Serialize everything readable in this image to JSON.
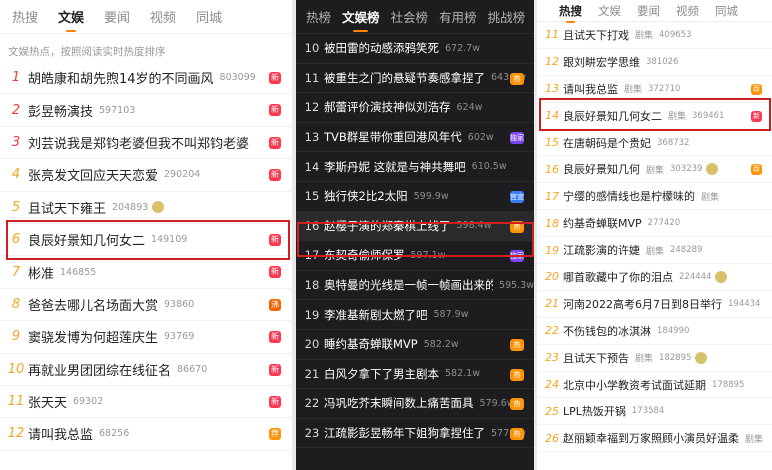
{
  "panel1": {
    "tabs": [
      {
        "label": "热搜",
        "active": false
      },
      {
        "label": "文娱",
        "active": true
      },
      {
        "label": "要闻",
        "active": false
      },
      {
        "label": "视频",
        "active": false
      },
      {
        "label": "同城",
        "active": false
      }
    ],
    "subhead": "文娱热点，按照阅读实时热度排序",
    "rows": [
      {
        "rank": "1",
        "title": "胡皓康和胡先煦14岁的不同画风",
        "heat": "803099",
        "badge": "新"
      },
      {
        "rank": "2",
        "title": "彭昱畅演技",
        "heat": "597103",
        "badge": "新"
      },
      {
        "rank": "3",
        "title": "刘芸说我是郑钧老婆但我不叫郑钧老婆",
        "heat": "",
        "badge": "新"
      },
      {
        "rank": "4",
        "title": "张亮发文回应天天恋爱",
        "heat": "290204",
        "badge": "新"
      },
      {
        "rank": "5",
        "title": "且试天下雍王",
        "heat": "204893",
        "badge": "",
        "emoji": true
      },
      {
        "rank": "6",
        "title": "良辰好景知几何女二",
        "heat": "149109",
        "badge": "新"
      },
      {
        "rank": "7",
        "title": "彬准",
        "heat": "146855",
        "badge": "新"
      },
      {
        "rank": "8",
        "title": "爸爸去哪儿名场面大赏",
        "heat": "93860",
        "badge": "沸"
      },
      {
        "rank": "9",
        "title": "窦骁发博为何超莲庆生",
        "heat": "93769",
        "badge": "新"
      },
      {
        "rank": "10",
        "title": "再就业男团团综在线征名",
        "heat": "86670",
        "badge": "新"
      },
      {
        "rank": "11",
        "title": "张天天",
        "heat": "69302",
        "badge": "新"
      },
      {
        "rank": "12",
        "title": "请叫我总监",
        "heat": "68256",
        "badge": "荐"
      }
    ]
  },
  "panel2": {
    "tabs": [
      {
        "label": "热榜",
        "active": false
      },
      {
        "label": "文娱榜",
        "active": true
      },
      {
        "label": "社会榜",
        "active": false
      },
      {
        "label": "有用榜",
        "active": false
      },
      {
        "label": "挑战榜",
        "active": false
      }
    ],
    "rows": [
      {
        "rank": "10",
        "title": "被田雷的动感添鸦笑死",
        "heat": "672.7w",
        "badge": ""
      },
      {
        "rank": "11",
        "title": "被重生之门的悬疑节奏感拿捏了",
        "heat": "643.6w",
        "badge": "热"
      },
      {
        "rank": "12",
        "title": "郝蕾评价演技神似刘浩存",
        "heat": "624w",
        "badge": ""
      },
      {
        "rank": "13",
        "title": "TVB群星带你重回港风年代",
        "heat": "602w",
        "badge": "独家"
      },
      {
        "rank": "14",
        "title": "李斯丹妮 这就是与神共舞吧",
        "heat": "610.5w",
        "badge": ""
      },
      {
        "rank": "15",
        "title": "独行侠2比2太阳",
        "heat": "599.9w",
        "badge": "官宣"
      },
      {
        "rank": "16",
        "title": "赵樱子演的郑秦棋上线了",
        "heat": "598.4w",
        "badge": "热"
      },
      {
        "rank": "17",
        "title": "东契奇偷师保罗",
        "heat": "597.1w",
        "badge": "独家"
      },
      {
        "rank": "18",
        "title": "奥特曼的光线是一帧一帧画出来的",
        "heat": "595.3w",
        "badge": ""
      },
      {
        "rank": "19",
        "title": "李准基新剧太燃了吧",
        "heat": "587.9w",
        "badge": ""
      },
      {
        "rank": "20",
        "title": "睡约基奇蝉联MVP",
        "heat": "582.2w",
        "badge": "热"
      },
      {
        "rank": "21",
        "title": "白风夕拿下了男主剧本",
        "heat": "582.1w",
        "badge": "热"
      },
      {
        "rank": "22",
        "title": "冯巩吃芥末瞬间数上痛苦面具",
        "heat": "579.6w",
        "badge": "热"
      },
      {
        "rank": "23",
        "title": "江疏影彭昱畅年下姐狗拿捏住了",
        "heat": "577.6w",
        "badge": "热"
      }
    ]
  },
  "panel3": {
    "tabs": [
      {
        "label": "热搜",
        "active": true
      },
      {
        "label": "文娱",
        "active": false
      },
      {
        "label": "要闻",
        "active": false
      },
      {
        "label": "视频",
        "active": false
      },
      {
        "label": "同城",
        "active": false
      }
    ],
    "rows": [
      {
        "rank": "11",
        "title": "且试天下打戏",
        "tag": "剧集",
        "heat": "409653",
        "badge": ""
      },
      {
        "rank": "12",
        "title": "跟刘畊宏学思维",
        "tag": "",
        "heat": "381026",
        "badge": ""
      },
      {
        "rank": "13",
        "title": "请叫我总监",
        "tag": "剧集",
        "heat": "372710",
        "badge": "荐"
      },
      {
        "rank": "14",
        "title": "良辰好景知几何女二",
        "tag": "剧集",
        "heat": "369461",
        "badge": "新"
      },
      {
        "rank": "15",
        "title": "在唐朝码是个贵妃",
        "tag": "",
        "heat": "368732",
        "badge": ""
      },
      {
        "rank": "16",
        "title": "良辰好景知几何",
        "tag": "剧集",
        "heat": "303239",
        "badge": "荐",
        "emoji": true
      },
      {
        "rank": "17",
        "title": "宁缨的感情线也是柠檬味的",
        "tag": "剧集",
        "heat": "",
        "badge": ""
      },
      {
        "rank": "18",
        "title": "约基奇蝉联MVP",
        "tag": "",
        "heat": "277420",
        "badge": ""
      },
      {
        "rank": "19",
        "title": "江疏影演的许婕",
        "tag": "剧集",
        "heat": "248289",
        "badge": ""
      },
      {
        "rank": "20",
        "title": "哪首歌藏中了你的泪点",
        "tag": "",
        "heat": "224444",
        "badge": "",
        "emoji": true
      },
      {
        "rank": "21",
        "title": "河南2022高考6月7日到8日举行",
        "tag": "",
        "heat": "194434",
        "badge": ""
      },
      {
        "rank": "22",
        "title": "不伤钱包的冰淇淋",
        "tag": "",
        "heat": "184990",
        "badge": ""
      },
      {
        "rank": "23",
        "title": "且试天下预告",
        "tag": "剧集",
        "heat": "182895",
        "badge": "",
        "emoji": true
      },
      {
        "rank": "24",
        "title": "北京中小学教资考试面试延期",
        "tag": "",
        "heat": "178895",
        "badge": ""
      },
      {
        "rank": "25",
        "title": "LPL热饭开锅",
        "tag": "",
        "heat": "173584",
        "badge": ""
      },
      {
        "rank": "26",
        "title": "赵丽颖幸福到万家照顾小演员好温柔",
        "tag": "剧集",
        "heat": "",
        "badge": ""
      }
    ]
  },
  "colors": {
    "accent": "#ff8200",
    "top_rank": "#f63b3b",
    "rank": "#f6a623",
    "highlight": "#d01f1f"
  }
}
